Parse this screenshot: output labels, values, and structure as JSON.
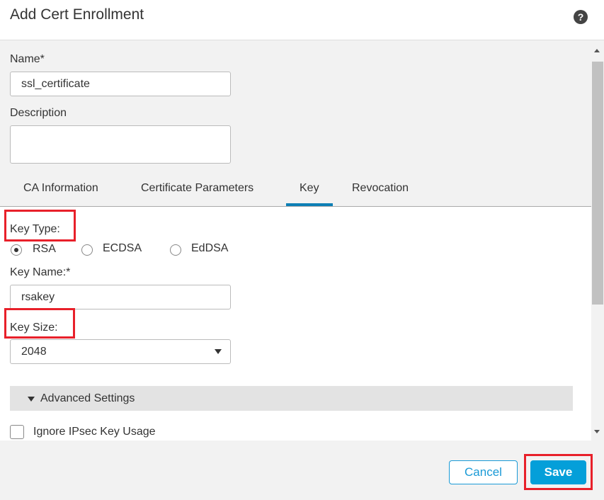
{
  "dialog": {
    "title": "Add Cert Enrollment",
    "help_icon": "question-circle-icon",
    "help_glyph": "?"
  },
  "form": {
    "name_label": "Name*",
    "name_value": "ssl_certificate",
    "description_label": "Description",
    "description_value": ""
  },
  "tabs": [
    {
      "label": "CA Information"
    },
    {
      "label": "Certificate Parameters"
    },
    {
      "label": "Key",
      "active": true
    },
    {
      "label": "Revocation"
    }
  ],
  "key": {
    "key_type_label": "Key Type:",
    "key_types": [
      {
        "label": "RSA",
        "selected": true
      },
      {
        "label": "ECDSA",
        "selected": false
      },
      {
        "label": "EdDSA",
        "selected": false
      }
    ],
    "key_name_label": "Key Name:*",
    "key_name_value": "rsakey",
    "key_size_label": "Key Size:",
    "key_size_value": "2048",
    "advanced_label": "Advanced Settings",
    "ignore_ipsec_label": "Ignore IPsec Key Usage",
    "ignore_ipsec_checked": false
  },
  "footer": {
    "cancel_label": "Cancel",
    "save_label": "Save"
  },
  "colors": {
    "accent": "#049fd9",
    "highlight": "#e8202a",
    "tab_active": "#0d7fb5"
  }
}
